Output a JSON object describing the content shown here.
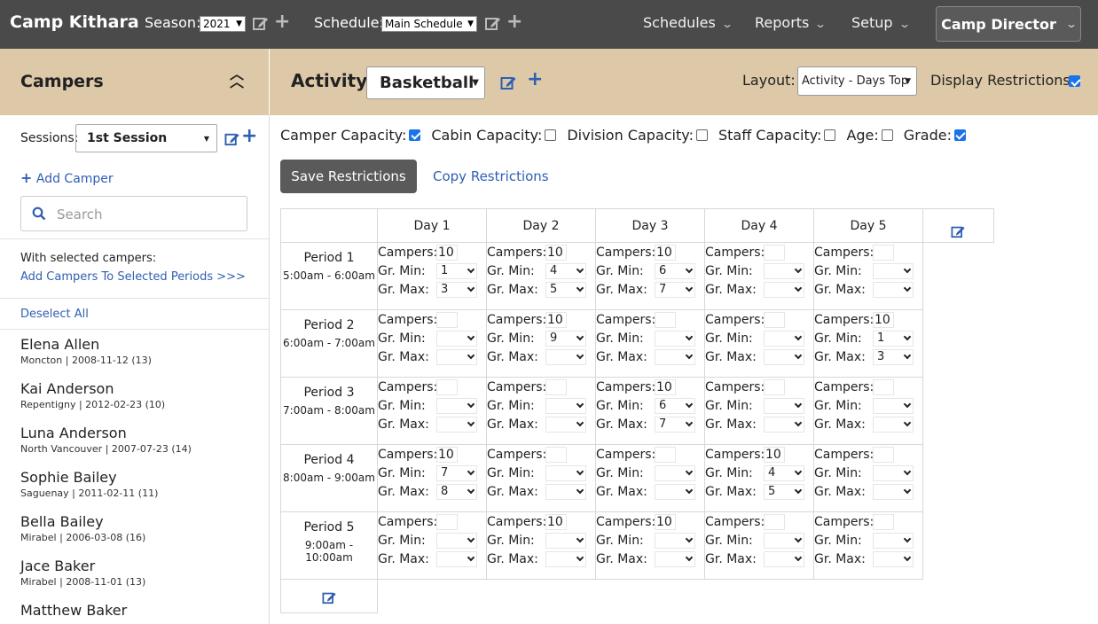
{
  "topbar": {
    "brand": "Camp Kithara",
    "season_label": "Season:",
    "season_value": "2021",
    "schedule_label": "Schedule:",
    "schedule_value": "Main Schedule",
    "menus": [
      "Schedules",
      "Reports",
      "Setup"
    ],
    "user": "Camp Director"
  },
  "left_header": {
    "title": "Campers"
  },
  "right_header": {
    "activity_label": "Activity:",
    "activity_value": "Basketball",
    "layout_label": "Layout:",
    "layout_value": "Activity - Days Top",
    "display_restrictions_label": "Display Restrictions:",
    "display_restrictions": true
  },
  "sidebar": {
    "sessions_label": "Sessions:",
    "session_value": "1st Session",
    "add_camper": "Add Camper",
    "search_placeholder": "Search",
    "with_selected": "With selected campers:",
    "add_to_periods": "Add Campers To Selected Periods >>>",
    "deselect_all": "Deselect All",
    "campers": [
      {
        "name": "Elena Allen",
        "meta": "Moncton | 2008-11-12 (13)"
      },
      {
        "name": "Kai Anderson",
        "meta": "Repentigny | 2012-02-23 (10)"
      },
      {
        "name": "Luna Anderson",
        "meta": "North Vancouver | 2007-07-23 (14)"
      },
      {
        "name": "Sophie Bailey",
        "meta": "Saguenay | 2011-02-11 (11)"
      },
      {
        "name": "Bella Bailey",
        "meta": "Mirabel | 2006-03-08 (16)"
      },
      {
        "name": "Jace Baker",
        "meta": "Mirabel | 2008-11-01 (13)"
      },
      {
        "name": "Matthew Baker",
        "meta": ""
      }
    ]
  },
  "filters": [
    {
      "label": "Camper Capacity:",
      "checked": true
    },
    {
      "label": "Cabin Capacity:",
      "checked": false
    },
    {
      "label": "Division Capacity:",
      "checked": false
    },
    {
      "label": "Staff Capacity:",
      "checked": false
    },
    {
      "label": "Age:",
      "checked": false
    },
    {
      "label": "Grade:",
      "checked": true
    }
  ],
  "save_restrictions": "Save Restrictions",
  "copy_restrictions": "Copy Restrictions",
  "grid": {
    "days": [
      "Day 1",
      "Day 2",
      "Day 3",
      "Day 4",
      "Day 5"
    ],
    "labels": {
      "campers": "Campers:",
      "gr_min": "Gr. Min:",
      "gr_max": "Gr. Max:"
    },
    "periods": [
      {
        "name": "Period 1",
        "time": "5:00am - 6:00am",
        "cells": [
          {
            "campers": "10",
            "min": "1",
            "max": "3"
          },
          {
            "campers": "10",
            "min": "4",
            "max": "5"
          },
          {
            "campers": "10",
            "min": "6",
            "max": "7"
          },
          {
            "campers": "",
            "min": "",
            "max": ""
          },
          {
            "campers": "",
            "min": "",
            "max": ""
          }
        ]
      },
      {
        "name": "Period 2",
        "time": "6:00am - 7:00am",
        "cells": [
          {
            "campers": "",
            "min": "",
            "max": ""
          },
          {
            "campers": "10",
            "min": "9",
            "max": ""
          },
          {
            "campers": "",
            "min": "",
            "max": ""
          },
          {
            "campers": "",
            "min": "",
            "max": ""
          },
          {
            "campers": "10",
            "min": "1",
            "max": "3"
          }
        ]
      },
      {
        "name": "Period 3",
        "time": "7:00am - 8:00am",
        "cells": [
          {
            "campers": "",
            "min": "",
            "max": ""
          },
          {
            "campers": "",
            "min": "",
            "max": ""
          },
          {
            "campers": "10",
            "min": "6",
            "max": "7"
          },
          {
            "campers": "",
            "min": "",
            "max": ""
          },
          {
            "campers": "",
            "min": "",
            "max": ""
          }
        ]
      },
      {
        "name": "Period 4",
        "time": "8:00am - 9:00am",
        "cells": [
          {
            "campers": "10",
            "min": "7",
            "max": "8"
          },
          {
            "campers": "",
            "min": "",
            "max": ""
          },
          {
            "campers": "",
            "min": "",
            "max": ""
          },
          {
            "campers": "10",
            "min": "4",
            "max": "5"
          },
          {
            "campers": "",
            "min": "",
            "max": ""
          }
        ]
      },
      {
        "name": "Period 5",
        "time": "9:00am - 10:00am",
        "cells": [
          {
            "campers": "",
            "min": "",
            "max": ""
          },
          {
            "campers": "10",
            "min": "",
            "max": ""
          },
          {
            "campers": "10",
            "min": "",
            "max": ""
          },
          {
            "campers": "",
            "min": "",
            "max": ""
          },
          {
            "campers": "",
            "min": "",
            "max": ""
          }
        ]
      }
    ]
  }
}
